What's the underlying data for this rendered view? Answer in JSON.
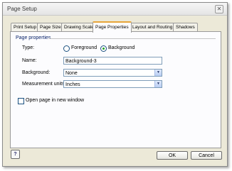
{
  "window": {
    "title": "Page Setup"
  },
  "tabs": [
    {
      "label": "Print Setup"
    },
    {
      "label": "Page Size"
    },
    {
      "label": "Drawing Scale"
    },
    {
      "label": "Page Properties"
    },
    {
      "label": "Layout and Routing"
    },
    {
      "label": "Shadows"
    }
  ],
  "active_tab": "Page Properties",
  "group": {
    "title": "Page properties"
  },
  "type": {
    "label": "Type:",
    "options": [
      {
        "label": "Foreground",
        "selected": false
      },
      {
        "label": "Background",
        "selected": true
      }
    ]
  },
  "name": {
    "label": "Name:",
    "value": "Background-3"
  },
  "background": {
    "label": "Background:",
    "value": "None"
  },
  "measurement_units": {
    "label": "Measurement units:",
    "value": "Inches"
  },
  "open_in_new_window": {
    "label": "Open page in new window",
    "checked": false
  },
  "buttons": {
    "ok": "OK",
    "cancel": "Cancel"
  },
  "icons": {
    "close": "close-icon",
    "help": "help-icon",
    "dropdown": "chevron-down-icon"
  },
  "colors": {
    "active_tab_accent": "#e8a63a",
    "radio_dot": "#21a121",
    "group_title": "#0a246a"
  }
}
